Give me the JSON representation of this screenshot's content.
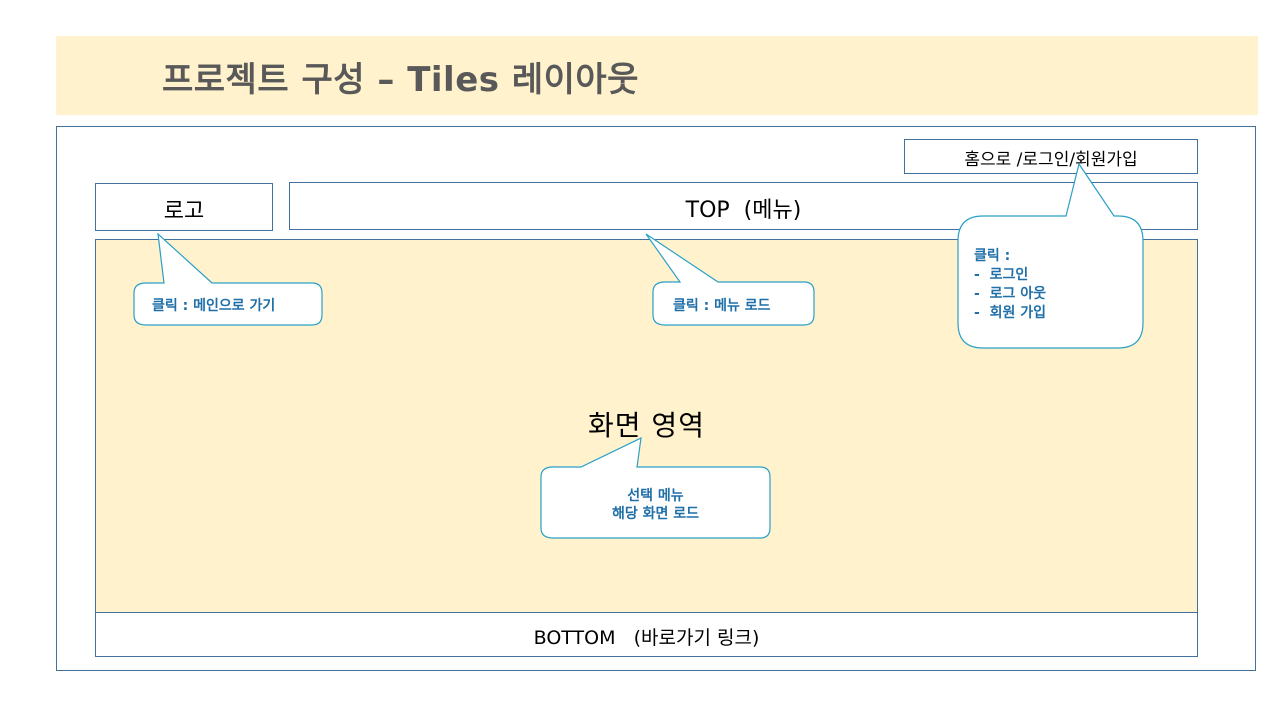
{
  "title": "프로젝트 구성 – Tiles 레이아웃",
  "layout": {
    "auth_links": "홈으로 /로그인/회원가입",
    "logo": "로고",
    "top": "TOP  (메뉴)",
    "content": "화면 영역",
    "bottom": "BOTTOM   (바로가기 링크)"
  },
  "callouts": {
    "logo": "클릭 : 메인으로 가기",
    "menu": "클릭 : 메뉴 로드",
    "auth_heading": "클릭 :",
    "auth_items": [
      "로그인",
      "로그 아웃",
      "회원 가입"
    ],
    "content_line1": "선택 메뉴",
    "content_line2": "해당 화면 로드"
  },
  "colors": {
    "title_bg": "#fff2cc",
    "content_bg": "#fff2cc",
    "border": "#41719c",
    "callout_border": "#2aa0c8",
    "callout_text": "#1f6fa8",
    "title_text": "#595959"
  }
}
